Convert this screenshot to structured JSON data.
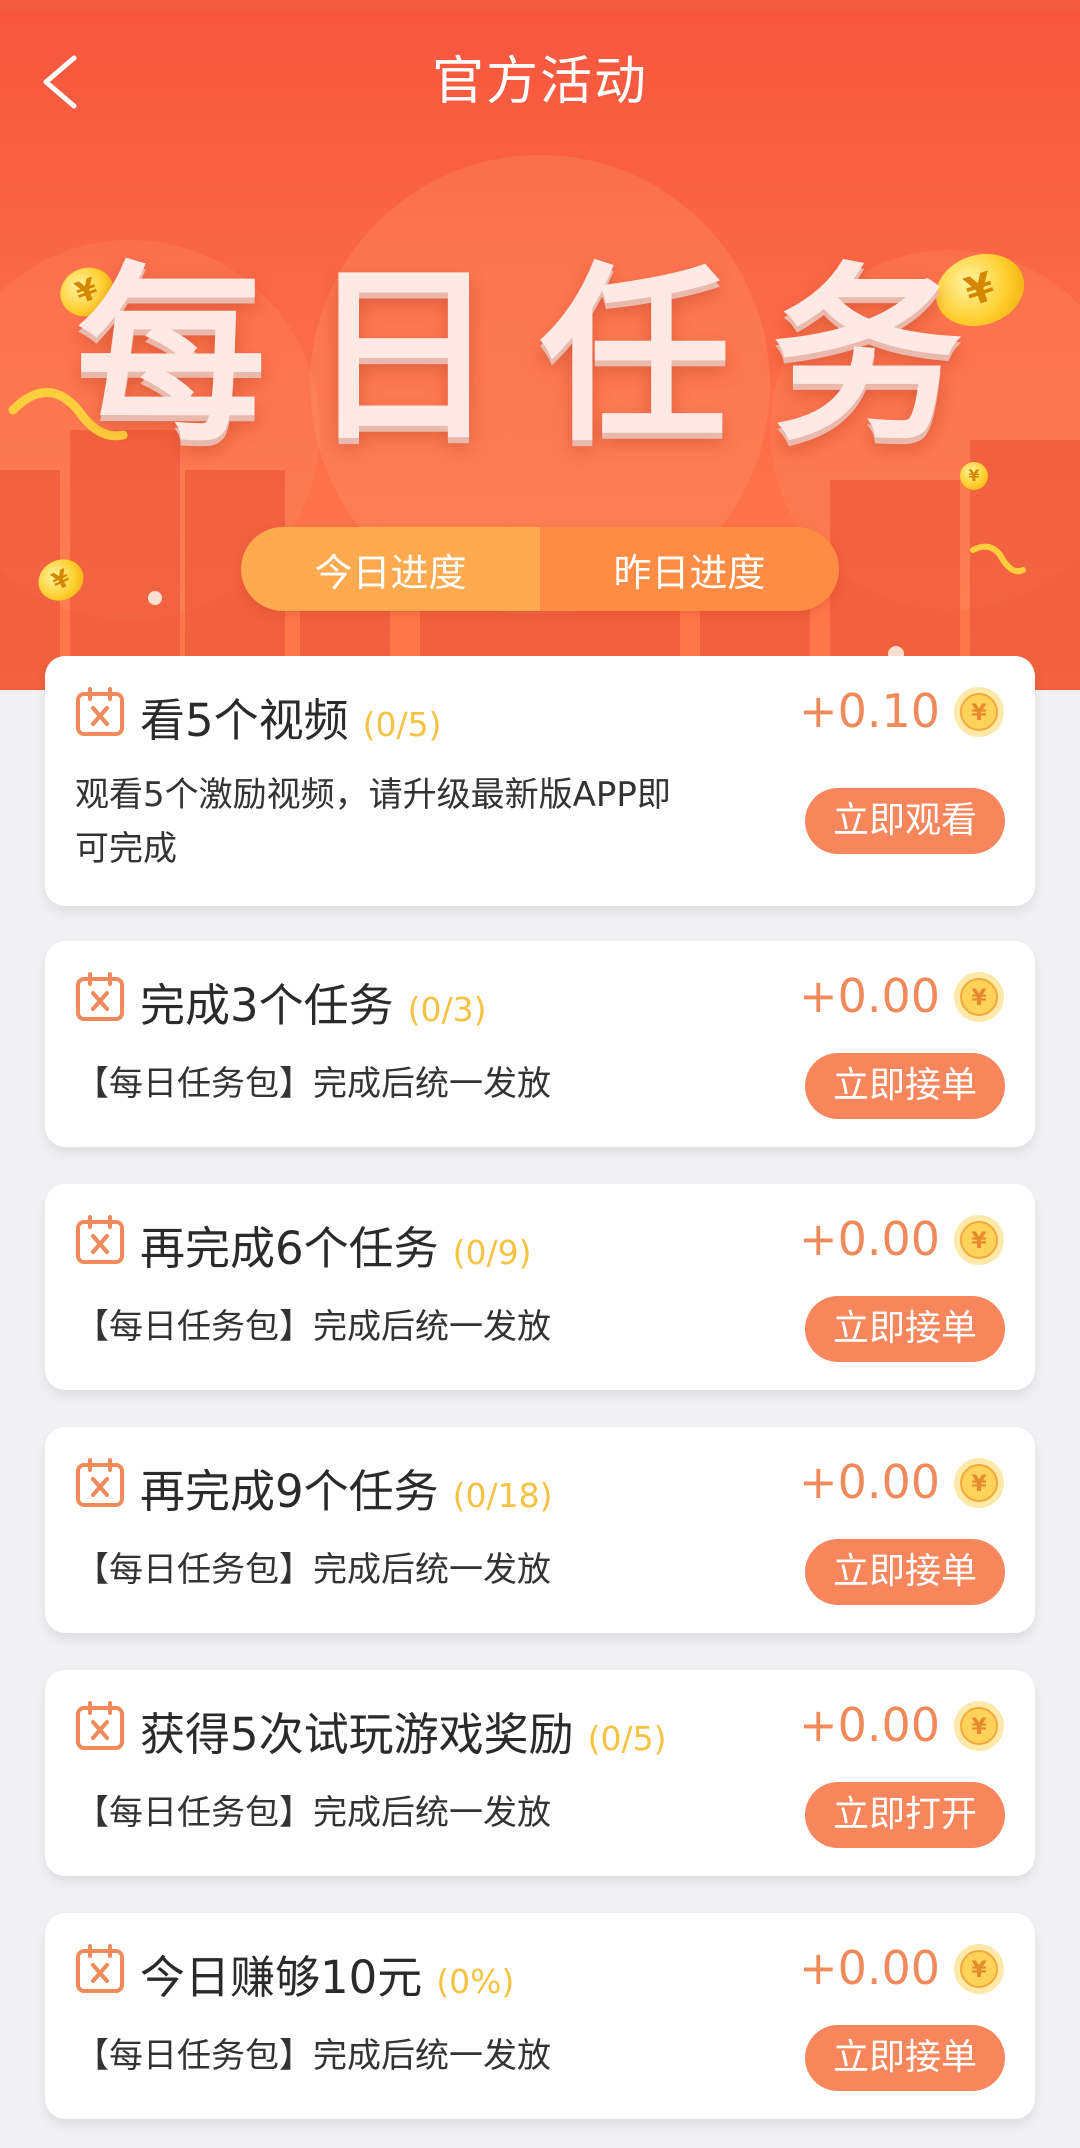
{
  "header": {
    "title": "官方活动",
    "hero_title": "每日任务"
  },
  "tabs": [
    {
      "label": "今日进度",
      "active": true
    },
    {
      "label": "昨日进度",
      "active": false
    }
  ],
  "colors": {
    "accent": "#f7865d",
    "reward": "#f08a5a",
    "progress": "#f5c242",
    "banner": "#f7553e"
  },
  "tasks": [
    {
      "name": "看5个视频",
      "progress": "(0/5)",
      "reward": "+0.10",
      "desc_line1": "观看5个激励视频，请升级最新版APP即",
      "desc_line2": "可完成",
      "button": "立即观看"
    },
    {
      "name": "完成3个任务",
      "progress": "(0/3)",
      "reward": "+0.00",
      "desc_line1": "【每日任务包】完成后统一发放",
      "button": "立即接单"
    },
    {
      "name": "再完成6个任务",
      "progress": "(0/9)",
      "reward": "+0.00",
      "desc_line1": "【每日任务包】完成后统一发放",
      "button": "立即接单"
    },
    {
      "name": "再完成9个任务",
      "progress": "(0/18)",
      "reward": "+0.00",
      "desc_line1": "【每日任务包】完成后统一发放",
      "button": "立即接单"
    },
    {
      "name": "获得5次试玩游戏奖励",
      "progress": "(0/5)",
      "reward": "+0.00",
      "desc_line1": "【每日任务包】完成后统一发放",
      "button": "立即打开"
    },
    {
      "name": "今日赚够10元",
      "progress": "(0%)",
      "reward": "+0.00",
      "desc_line1": "【每日任务包】完成后统一发放",
      "button": "立即接单"
    }
  ],
  "icons": {
    "back": "chevron-left-icon",
    "task": "calendar-x-icon",
    "coin": "yuan-coin-icon"
  }
}
